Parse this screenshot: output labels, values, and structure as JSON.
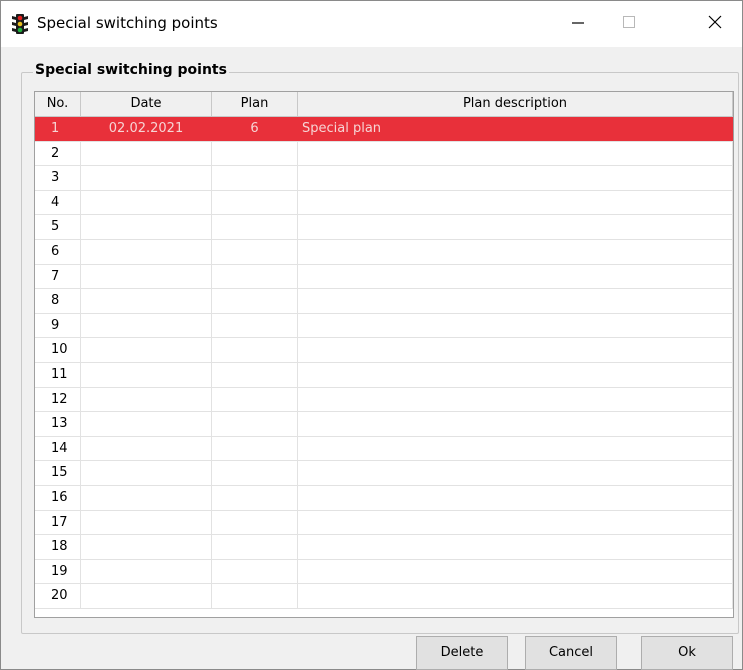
{
  "window": {
    "title": "Special switching points"
  },
  "group": {
    "legend": "Special switching points"
  },
  "table": {
    "columns": [
      "No.",
      "Date",
      "Plan",
      "Plan description"
    ],
    "rows": [
      {
        "no": "1",
        "date": "02.02.2021",
        "plan": "6",
        "description": "Special plan",
        "selected": true
      },
      {
        "no": "2",
        "date": "",
        "plan": "",
        "description": ""
      },
      {
        "no": "3",
        "date": "",
        "plan": "",
        "description": ""
      },
      {
        "no": "4",
        "date": "",
        "plan": "",
        "description": ""
      },
      {
        "no": "5",
        "date": "",
        "plan": "",
        "description": ""
      },
      {
        "no": "6",
        "date": "",
        "plan": "",
        "description": ""
      },
      {
        "no": "7",
        "date": "",
        "plan": "",
        "description": ""
      },
      {
        "no": "8",
        "date": "",
        "plan": "",
        "description": ""
      },
      {
        "no": "9",
        "date": "",
        "plan": "",
        "description": ""
      },
      {
        "no": "10",
        "date": "",
        "plan": "",
        "description": ""
      },
      {
        "no": "11",
        "date": "",
        "plan": "",
        "description": ""
      },
      {
        "no": "12",
        "date": "",
        "plan": "",
        "description": ""
      },
      {
        "no": "13",
        "date": "",
        "plan": "",
        "description": ""
      },
      {
        "no": "14",
        "date": "",
        "plan": "",
        "description": ""
      },
      {
        "no": "15",
        "date": "",
        "plan": "",
        "description": ""
      },
      {
        "no": "16",
        "date": "",
        "plan": "",
        "description": ""
      },
      {
        "no": "17",
        "date": "",
        "plan": "",
        "description": ""
      },
      {
        "no": "18",
        "date": "",
        "plan": "",
        "description": ""
      },
      {
        "no": "19",
        "date": "",
        "plan": "",
        "description": ""
      },
      {
        "no": "20",
        "date": "",
        "plan": "",
        "description": ""
      }
    ]
  },
  "buttons": {
    "delete": "Delete",
    "cancel": "Cancel",
    "ok": "Ok"
  },
  "icons": {
    "app": "traffic-light-icon",
    "minimize": "minimize-icon",
    "maximize": "maximize-icon",
    "close": "close-icon"
  },
  "colors": {
    "selected_row": "#e8303a",
    "selected_text": "#f6d4d4"
  }
}
